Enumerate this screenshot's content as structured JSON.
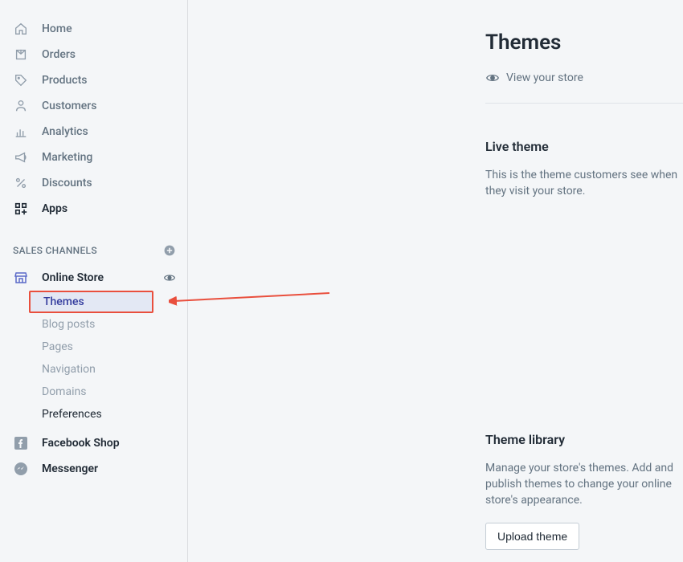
{
  "sidebar": {
    "nav": [
      {
        "name": "home",
        "label": "Home",
        "icon": "home-icon"
      },
      {
        "name": "orders",
        "label": "Orders",
        "icon": "orders-icon"
      },
      {
        "name": "products",
        "label": "Products",
        "icon": "products-icon"
      },
      {
        "name": "customers",
        "label": "Customers",
        "icon": "customers-icon"
      },
      {
        "name": "analytics",
        "label": "Analytics",
        "icon": "analytics-icon"
      },
      {
        "name": "marketing",
        "label": "Marketing",
        "icon": "marketing-icon"
      },
      {
        "name": "discounts",
        "label": "Discounts",
        "icon": "discounts-icon"
      },
      {
        "name": "apps",
        "label": "Apps",
        "icon": "apps-icon",
        "active": true
      }
    ],
    "section_label": "SALES CHANNELS",
    "channels": [
      {
        "name": "online-store",
        "label": "Online Store",
        "icon": "store-icon",
        "hasEye": true,
        "subitems": [
          {
            "name": "themes",
            "label": "Themes",
            "highlighted": true
          },
          {
            "name": "blog-posts",
            "label": "Blog posts"
          },
          {
            "name": "pages",
            "label": "Pages"
          },
          {
            "name": "navigation",
            "label": "Navigation"
          },
          {
            "name": "domains",
            "label": "Domains"
          },
          {
            "name": "preferences",
            "label": "Preferences",
            "dark": true
          }
        ]
      },
      {
        "name": "facebook-shop",
        "label": "Facebook Shop",
        "icon": "facebook-icon"
      },
      {
        "name": "messenger",
        "label": "Messenger",
        "icon": "messenger-icon"
      }
    ]
  },
  "content": {
    "title": "Themes",
    "view_store_label": "View your store",
    "live_theme": {
      "title": "Live theme",
      "desc": "This is the theme customers see when they visit your store."
    },
    "theme_library": {
      "title": "Theme library",
      "desc": "Manage your store's themes. Add and publish themes to change your online store's appearance.",
      "upload_label": "Upload theme"
    }
  }
}
